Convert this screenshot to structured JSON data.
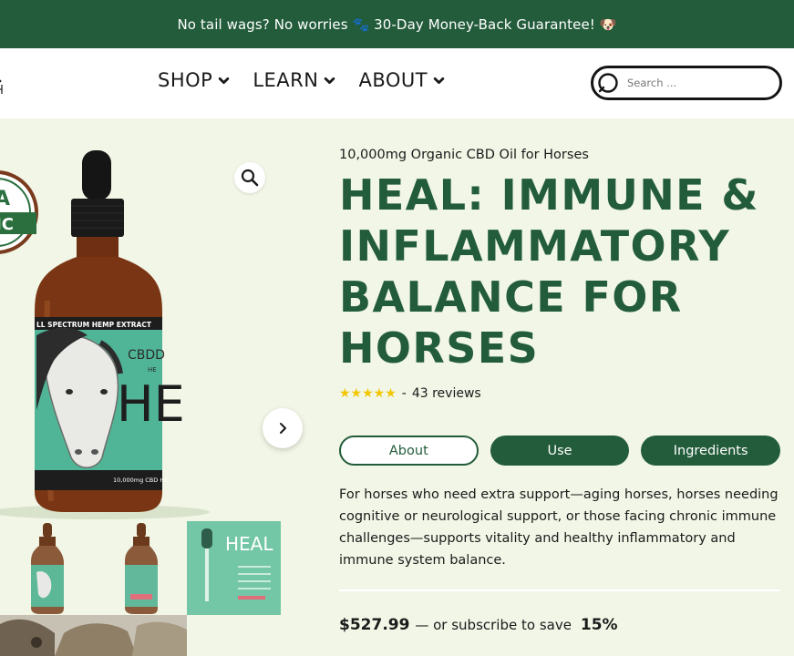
{
  "announcement": {
    "text": "No tail wags? No worries 🐾 30-Day Money-Back Guarantee! 🐶"
  },
  "header": {
    "logo_fragment": "·\nH",
    "nav": [
      {
        "label": "SHOP"
      },
      {
        "label": "LEARN"
      },
      {
        "label": "ABOUT"
      }
    ],
    "search": {
      "placeholder": "Search ..."
    }
  },
  "gallery": {
    "seal_text_1": "A",
    "seal_text_2": "NIC",
    "label_band": "LL SPECTRUM HEMP EXTRACT",
    "brand_fragment": "CBDD",
    "brand_fragment2": "HE",
    "bottle_heal": "HE",
    "bottle_mg": "10,000mg CBD HO",
    "thumb3_title": "HEAL"
  },
  "product": {
    "subtitle": "10,000mg Organic CBD Oil for Horses",
    "title": "HEAL: IMMUNE & INFLAMMATORY BALANCE FOR HORSES",
    "rating": {
      "stars": "★★★★★",
      "value": 5,
      "separator": "-",
      "reviews": "43 reviews"
    },
    "tabs": [
      {
        "label": "About",
        "active": true
      },
      {
        "label": "Use",
        "active": false
      },
      {
        "label": "Ingredients",
        "active": false
      }
    ],
    "description": "For horses who need extra support—aging horses, horses needing cognitive or neurological support, or those facing chronic immune challenges—supports vitality and healthy inflammatory and immune system balance.",
    "price": {
      "amount": "$527.99",
      "subscribe_text": "— or subscribe to save",
      "save_percent": "15%"
    }
  },
  "colors": {
    "brand_green": "#235c3b",
    "page_bg": "#f1f6e6",
    "star": "#f2c600"
  }
}
